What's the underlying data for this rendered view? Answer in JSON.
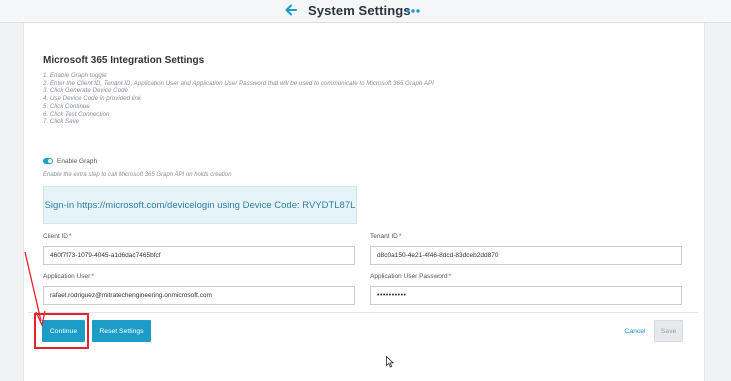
{
  "header": {
    "title": "System Settings"
  },
  "settings": {
    "title": "Microsoft 365 Integration Settings",
    "steps": [
      "1. Enable Graph toggle",
      "2. Enter the Client ID, Tenant ID, Application User and Application User Password that will be used to communicate to Microsoft 365 Graph API",
      "3. Click Generate Device Code",
      "4. Use Device Code in provided link",
      "5. Click Continue",
      "6. Click Test Connection",
      "7. Click Save"
    ],
    "enable_graph": {
      "label": "Enable Graph",
      "hint": "Enable the extra step to call Microsoft 365 Graph API on holds creation",
      "checked": true
    },
    "device_code": {
      "prefix": "Sign-in ",
      "link": "https://microsoft.com/devicelogin",
      "suffix": " using Device Code: RVYDTL87L"
    },
    "fields": {
      "client_id": {
        "label": "Client ID",
        "required": "*",
        "value": "460f7f73-1079-4045-a1d6dac7465bfcf"
      },
      "tenant_id": {
        "label": "Tenant ID",
        "required": "*",
        "value": "d8c0a150-4e21-4f46-8dcd-83dceb2dd870"
      },
      "app_user": {
        "label": "Application User",
        "required": "*",
        "value": "rafael.rodriguez@mitratechengineering.onmicrosoft.com"
      },
      "app_password": {
        "label": "Application User Password",
        "required": "*",
        "value": "••••••••••"
      }
    }
  },
  "footer": {
    "continue_label": "Continue",
    "reset_label": "Reset Settings",
    "cancel_label": "Cancel",
    "save_label": "Save"
  },
  "colors": {
    "accent": "#1b9dc8",
    "required": "#d6353b",
    "annotation": "#e3232c"
  },
  "icons": {
    "back": "arrow-left-icon",
    "more": "more-horizontal-icon"
  }
}
